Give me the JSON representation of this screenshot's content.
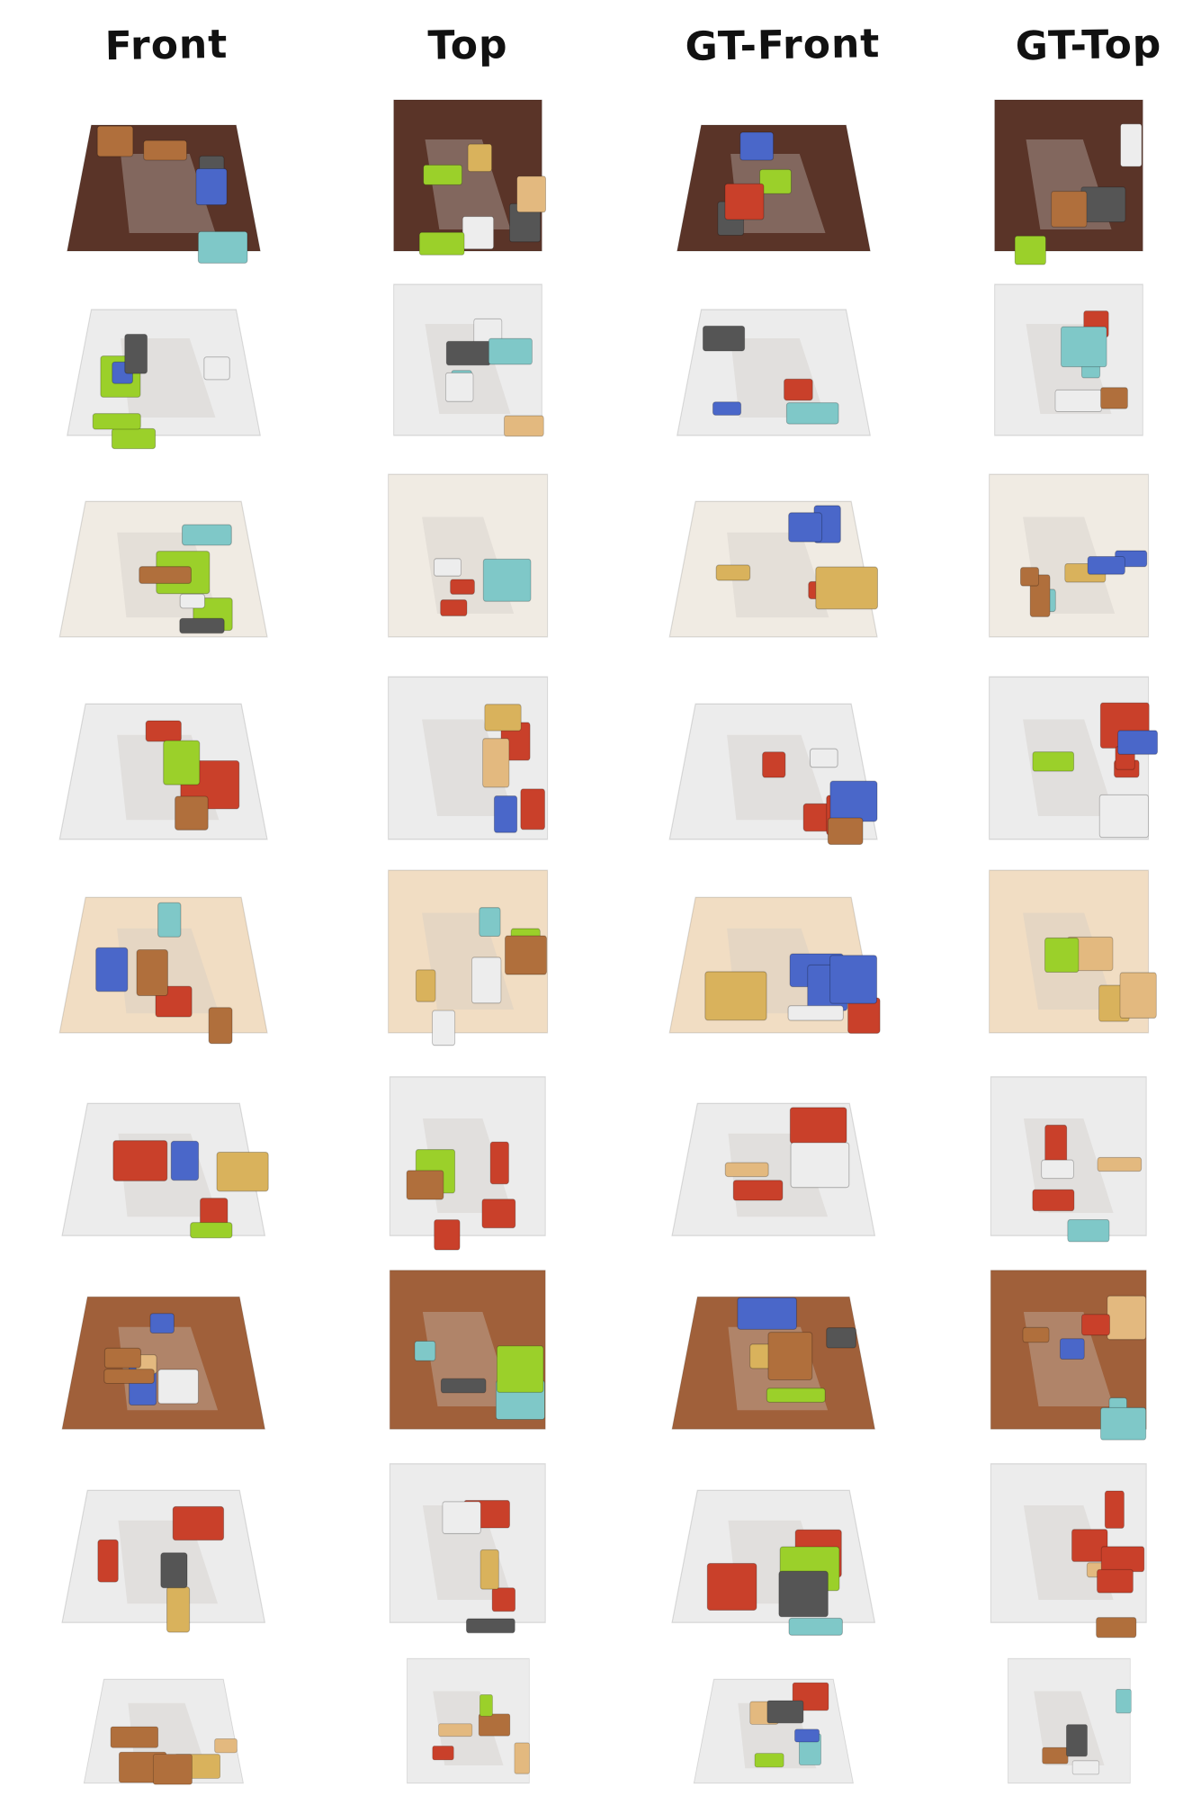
{
  "headers": [
    "Front",
    "Top",
    "GT-Front",
    "GT-Top"
  ],
  "palette": {
    "wood_dark": "#5a3428",
    "wood_medium": "#a0603a",
    "wood_light": "#f1ddc3",
    "marble": "#ececec",
    "marble_warm": "#f0ebe3",
    "kitchen_red": "#c9402a",
    "shadow": "#cfc9c2"
  },
  "rows": [
    {
      "floor": "wood_dark"
    },
    {
      "floor": "marble"
    },
    {
      "floor": "marble_warm"
    },
    {
      "floor": "marble"
    },
    {
      "floor": "wood_light"
    },
    {
      "floor": "marble"
    },
    {
      "floor": "wood_medium"
    },
    {
      "floor": "marble"
    },
    {
      "floor": "marble"
    }
  ]
}
